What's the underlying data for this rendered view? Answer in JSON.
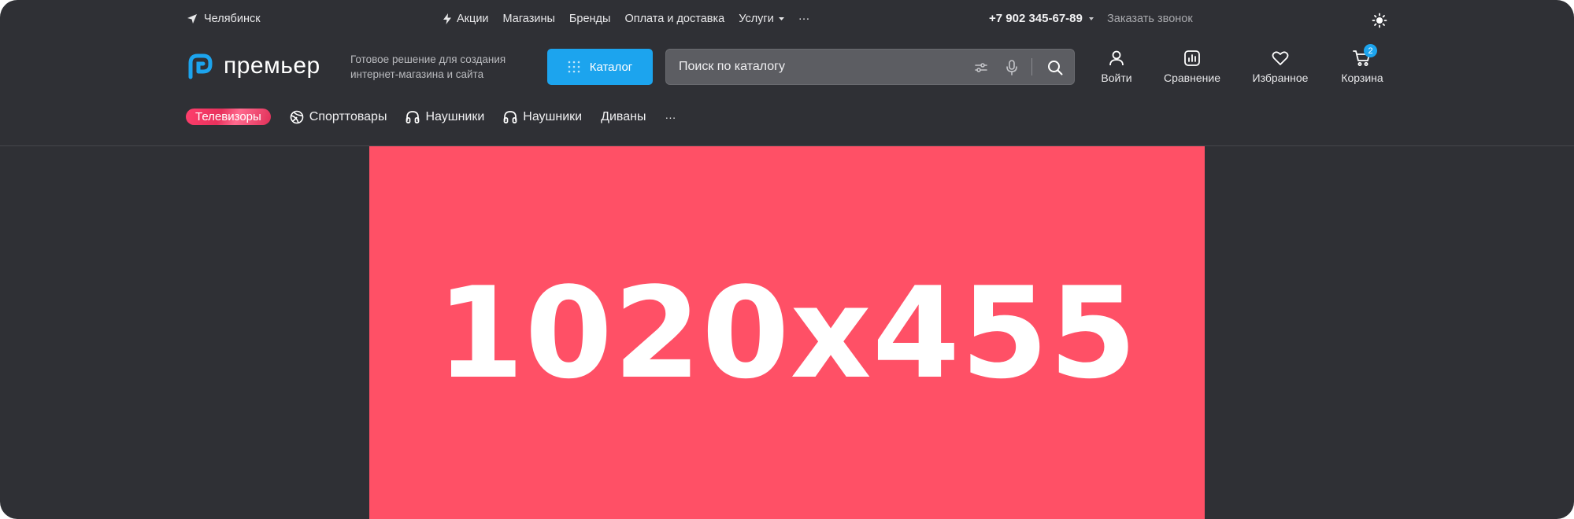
{
  "topbar": {
    "city": "Челябинск",
    "nav": [
      {
        "label": "Акции",
        "icon": "lightning-icon"
      },
      {
        "label": "Магазины"
      },
      {
        "label": "Бренды"
      },
      {
        "label": "Оплата и доставка"
      },
      {
        "label": "Услуги",
        "icon": "caret-down-icon"
      }
    ],
    "more": "···",
    "phone": "+7 902 345-67-89",
    "callback": "Заказать звонок"
  },
  "header": {
    "logo": "премьер",
    "tagline": "Готовое решение для создания интернет-магазина и сайта",
    "catalog_label": "Каталог",
    "search_placeholder": "Поиск по каталогу",
    "actions": {
      "login": "Войти",
      "compare": "Сравнение",
      "favorites": "Избранное",
      "cart": "Корзина",
      "cart_count": "2"
    }
  },
  "catnav": {
    "items": [
      "Телевизоры",
      "Спорттовары",
      "Наушники",
      "Наушники",
      "Диваны"
    ],
    "more": "···"
  },
  "banner": {
    "text": "1020x455",
    "color": "#ff5066"
  },
  "colors": {
    "background": "#2f3035",
    "accent": "#1ca4ee",
    "search_bg": "#5c5d62"
  }
}
